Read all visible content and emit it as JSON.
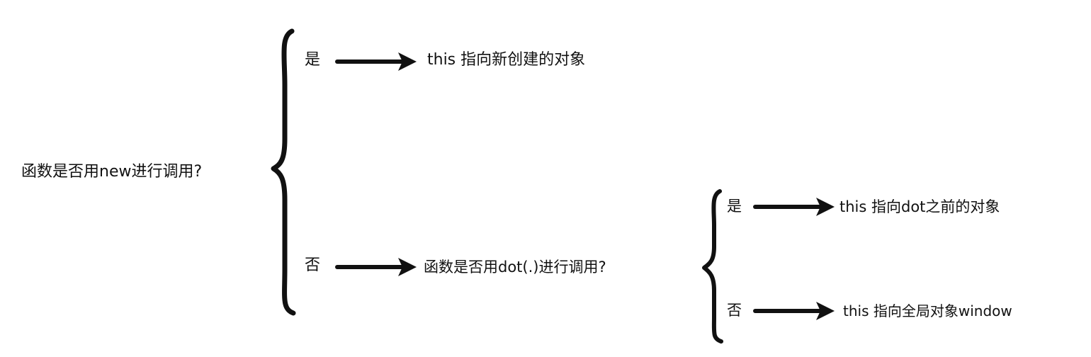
{
  "root_question": "函数是否用new进行调用?",
  "branch_yes": {
    "label": "是",
    "result": "this 指向新创建的对象"
  },
  "branch_no": {
    "label": "否",
    "question": "函数是否用dot(.)进行调用?",
    "branch_yes": {
      "label": "是",
      "result": "this 指向dot之前的对象"
    },
    "branch_no": {
      "label": "否",
      "result": "this 指向全局对象window"
    }
  },
  "colors": {
    "ink": "#111111",
    "background": "#ffffff"
  }
}
